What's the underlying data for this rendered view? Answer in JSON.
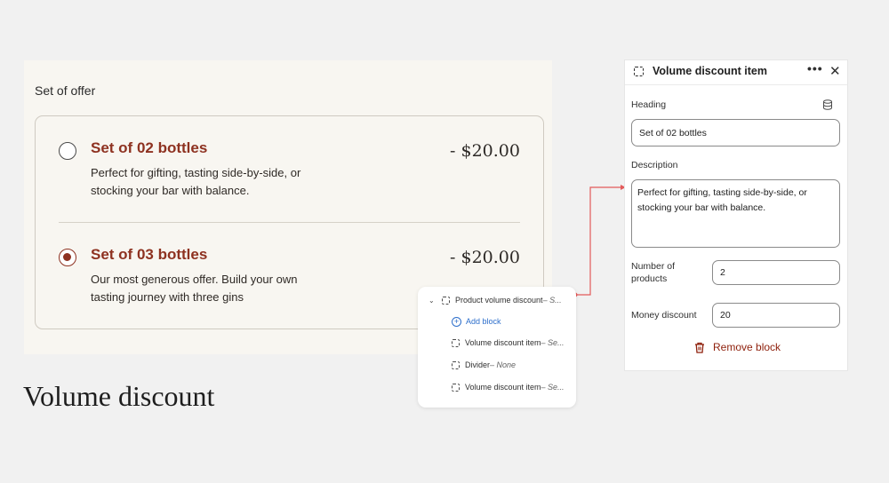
{
  "preview": {
    "offer_title": "Set of offer",
    "options": [
      {
        "name": "Set of 02 bottles",
        "description": "Perfect for gifting, tasting side-by-side, or stocking your bar with balance.",
        "price": "- $20.00",
        "selected": false
      },
      {
        "name": "Set of 03 bottles",
        "description": "Our most generous offer. Build your own tasting journey with three gins",
        "price": "- $20.00",
        "selected": true
      }
    ],
    "caption": "Volume discount"
  },
  "tree": {
    "parent_label": "Product volume discount",
    "parent_sub": " – S...",
    "add_block": "Add block",
    "children": [
      {
        "label": "Volume discount item",
        "sub": " – Se..."
      },
      {
        "label": "Divider",
        "sub": " – None"
      },
      {
        "label": "Volume discount item",
        "sub": " – Se..."
      }
    ]
  },
  "panel": {
    "title": "Volume discount item",
    "more_icon": "•••",
    "close_icon": "✕",
    "heading_label": "Heading",
    "heading_value": "Set of 02 bottles",
    "description_label": "Description",
    "description_value": "Perfect for gifting, tasting side-by-side, or stocking your bar with balance.",
    "products_label": "Number of products",
    "products_value": "2",
    "money_label": "Money discount",
    "money_value": "20",
    "remove_label": "Remove block"
  },
  "colors": {
    "accent": "#8e3221",
    "link": "#2c6ecb",
    "connector": "#e35a5a",
    "remove": "#8e1f0b"
  }
}
